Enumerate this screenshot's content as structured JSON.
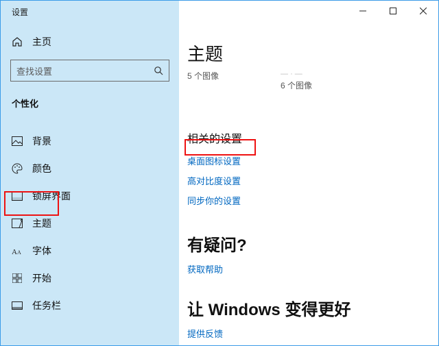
{
  "window": {
    "title": "设置"
  },
  "sidebar": {
    "home": "主页",
    "search_placeholder": "查找设置",
    "section": "个性化",
    "items": [
      {
        "label": "背景"
      },
      {
        "label": "颜色"
      },
      {
        "label": "锁屏界面"
      },
      {
        "label": "主题"
      },
      {
        "label": "字体"
      },
      {
        "label": "开始"
      },
      {
        "label": "任务栏"
      }
    ]
  },
  "content": {
    "heading": "主题",
    "thumb1": "5 个图像",
    "thumb2": "6 个图像",
    "related_heading": "相关的设置",
    "links": {
      "desktop_icons": "桌面图标设置",
      "high_contrast": "高对比度设置",
      "sync": "同步你的设置"
    },
    "help_heading": "有疑问?",
    "help_link": "获取帮助",
    "feedback_heading": "让 Windows 变得更好",
    "feedback_link": "提供反馈"
  }
}
